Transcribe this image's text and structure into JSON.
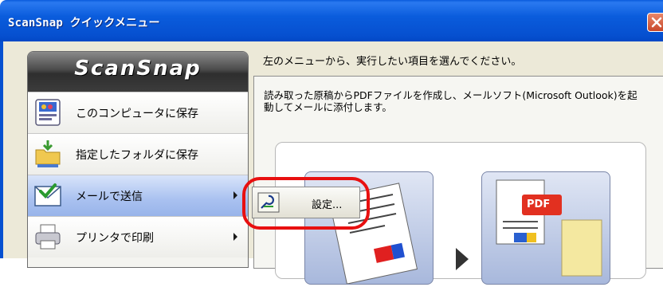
{
  "window": {
    "title": "ScanSnap クイックメニュー",
    "close_icon": "close-x-icon"
  },
  "sidebar": {
    "logo": "ScanSnap",
    "items": [
      {
        "label": "このコンピュータに保存",
        "icon": "scansnap-organizer-icon",
        "has_submenu": false,
        "active": false
      },
      {
        "label": "指定したフォルダに保存",
        "icon": "folder-save-icon",
        "has_submenu": false,
        "active": false
      },
      {
        "label": "メールで送信",
        "icon": "mail-send-icon",
        "has_submenu": true,
        "active": true
      },
      {
        "label": "プリンタで印刷",
        "icon": "printer-icon",
        "has_submenu": true,
        "active": false
      }
    ]
  },
  "submenu": {
    "settings_label": "設定...",
    "icon": "settings-icon"
  },
  "content": {
    "instruction": "左のメニューから、実行したい項目を選んでください。",
    "description": "読み取った原稿からPDFファイルを作成し、メールソフト(Microsoft Outlook)を起動してメールに添付します。",
    "preview": {
      "pdf_badge": "PDF"
    }
  },
  "colors": {
    "titlebar": "#0650d0",
    "highlight_ring": "#e81010",
    "active_item": "#a9c1f0"
  }
}
